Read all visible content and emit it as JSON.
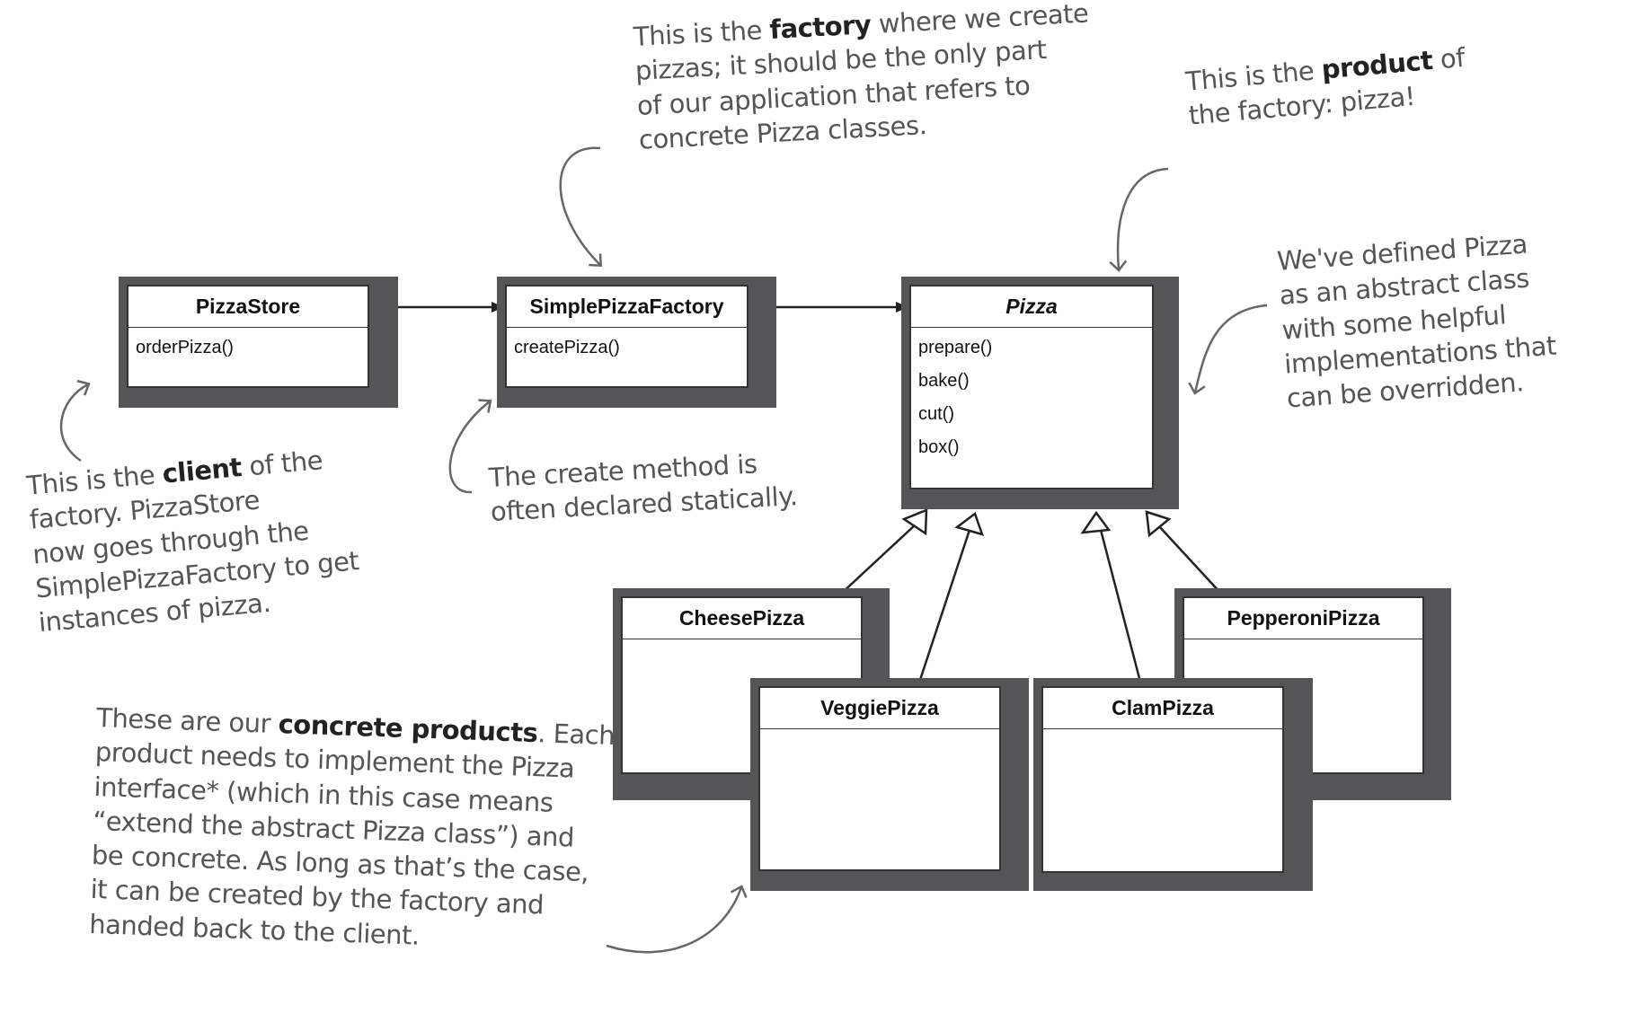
{
  "classes": {
    "pizzastore": {
      "name": "PizzaStore",
      "methods": [
        "orderPizza()"
      ]
    },
    "factory": {
      "name": "SimplePizzaFactory",
      "methods": [
        "createPizza()"
      ]
    },
    "pizza": {
      "name": "Pizza",
      "methods": [
        "prepare()",
        "bake()",
        "cut()",
        "box()"
      ]
    },
    "cheese": {
      "name": "CheesePizza"
    },
    "pepperoni": {
      "name": "PepperoniPizza"
    },
    "veggie": {
      "name": "VeggiePizza"
    },
    "clam": {
      "name": "ClamPizza"
    }
  },
  "notes": {
    "factory": {
      "lines": [
        "This is the ",
        "factory",
        " where we create",
        "pizzas; it should be the only part",
        "of our application that refers to",
        "concrete Pizza classes."
      ]
    },
    "product": {
      "l1a": "This is the ",
      "l1b": "product",
      "l1c": " of",
      "l2": "the factory: pizza!"
    },
    "abstract": {
      "lines": [
        "We've defined Pizza",
        "as an abstract class",
        "with some helpful",
        "implementations that",
        "can be overridden."
      ]
    },
    "client": {
      "l1a": "This is the ",
      "l1b": "client",
      "l1c": " of the",
      "lines": [
        "factory. PizzaStore",
        "now goes through the",
        "SimplePizzaFactory to get",
        "instances of pizza."
      ]
    },
    "create": {
      "lines": [
        "The create method is",
        "often declared statically."
      ]
    },
    "concrete": {
      "l1a": "These are our ",
      "l1b": "concrete products",
      "l1c": ". Each",
      "lines": [
        "product needs to implement the Pizza",
        "interface* (which in this case means",
        "“extend the abstract Pizza class”) and",
        "be concrete. As long as that’s the case,",
        "it can be created by the factory and",
        "handed back to the client."
      ]
    }
  },
  "colors": {
    "shadow": "#555558",
    "ink": "#333333",
    "handwriting": "#555555"
  }
}
